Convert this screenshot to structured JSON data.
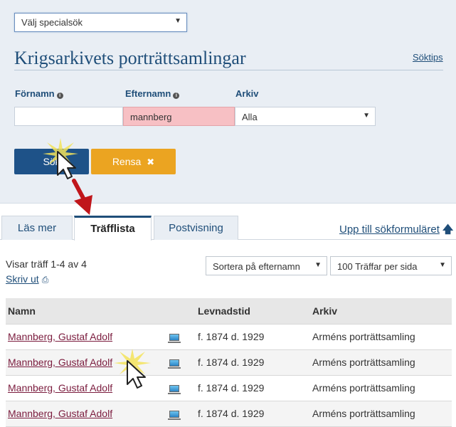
{
  "search_form": {
    "special_search_select": "Välj specialsök",
    "title": "Krigsarkivets porträttsamlingar",
    "help_link": "Söktips",
    "fields": {
      "fornamn_label": "Förnamn",
      "fornamn_value": "",
      "efternamn_label": "Efternamn",
      "efternamn_value": "mannberg",
      "arkiv_label": "Arkiv",
      "arkiv_value": "Alla"
    },
    "search_button": "Sök",
    "clear_button": "Rensa"
  },
  "tabs": [
    {
      "label": "Läs mer",
      "active": false
    },
    {
      "label": "Träfflista",
      "active": true
    },
    {
      "label": "Postvisning",
      "active": false
    }
  ],
  "back_to_form_link": "Upp till sökformuläret",
  "results": {
    "count_text": "Visar träff 1-4 av 4",
    "print_link": "Skriv ut",
    "sort_select": "Sortera på efternamn",
    "per_page_select": "100 Träffar per sida",
    "columns": [
      "Namn",
      "",
      "Levnadstid",
      "Arkiv"
    ],
    "rows": [
      {
        "name": "Mannberg, Gustaf Adolf",
        "icon": "computer-icon",
        "lifetime": "f. 1874 d. 1929",
        "archive": "Arméns porträttsamling"
      },
      {
        "name": "Mannberg, Gustaf Adolf",
        "icon": "computer-icon",
        "lifetime": "f. 1874 d. 1929",
        "archive": "Arméns porträttsamling"
      },
      {
        "name": "Mannberg, Gustaf Adolf",
        "icon": "computer-icon",
        "lifetime": "f. 1874 d. 1929",
        "archive": "Arméns porträttsamling"
      },
      {
        "name": "Mannberg, Gustaf Adolf",
        "icon": "computer-icon",
        "lifetime": "f. 1874 d. 1929",
        "archive": "Arméns porträttsamling"
      }
    ]
  },
  "colors": {
    "brand_blue": "#1e5288",
    "title_blue": "#1f4e79",
    "clear_orange": "#eba421",
    "error_pink": "#f7c0c4",
    "link_maroon": "#7b1c3e",
    "annotation_arrow": "#c0161b"
  }
}
